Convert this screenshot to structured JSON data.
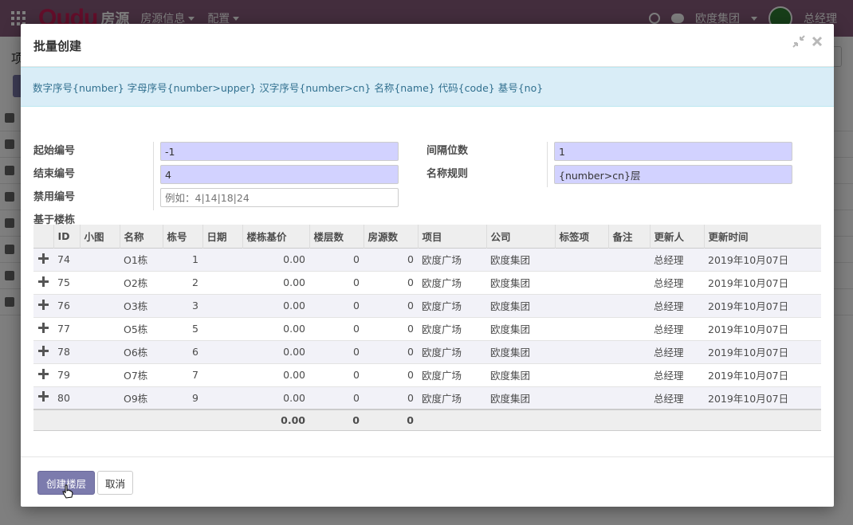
{
  "app": {
    "brand": "Oudu",
    "brand_sub": "房源",
    "menu": [
      "房源信息",
      "配置"
    ],
    "company": "欧度集团",
    "user": "总经理",
    "page_title": "项"
  },
  "modal": {
    "title": "批量创建",
    "info": "数字序号{number} 字母序号{number>upper} 汉字序号{number>cn} 名称{name} 代码{code} 基号{no}",
    "form": {
      "start_label": "起始编号",
      "start_value": "-1",
      "end_label": "结束编号",
      "end_value": "4",
      "disabled_label": "禁用编号",
      "disabled_placeholder": "例如：4|14|18|24",
      "interval_label": "间隔位数",
      "interval_value": "1",
      "name_rule_label": "名称规则",
      "name_rule_value": "{number>cn}层",
      "based_on_label": "基于楼栋"
    },
    "table": {
      "columns": [
        "",
        "ID",
        "小图",
        "名称",
        "栋号",
        "日期",
        "楼栋基价",
        "楼层数",
        "房源数",
        "项目",
        "公司",
        "标签项",
        "备注",
        "更新人",
        "更新时间"
      ],
      "rows": [
        {
          "id": "74",
          "thumb": "",
          "name": "O1栋",
          "no": "1",
          "date": "",
          "price": "0.00",
          "floors": "0",
          "rooms": "0",
          "project": "欧度广场",
          "company": "欧度集团",
          "tags": "",
          "note": "",
          "updater": "总经理",
          "updated": "2019年10月07日"
        },
        {
          "id": "75",
          "thumb": "",
          "name": "O2栋",
          "no": "2",
          "date": "",
          "price": "0.00",
          "floors": "0",
          "rooms": "0",
          "project": "欧度广场",
          "company": "欧度集团",
          "tags": "",
          "note": "",
          "updater": "总经理",
          "updated": "2019年10月07日"
        },
        {
          "id": "76",
          "thumb": "",
          "name": "O3栋",
          "no": "3",
          "date": "",
          "price": "0.00",
          "floors": "0",
          "rooms": "0",
          "project": "欧度广场",
          "company": "欧度集团",
          "tags": "",
          "note": "",
          "updater": "总经理",
          "updated": "2019年10月07日"
        },
        {
          "id": "77",
          "thumb": "",
          "name": "O5栋",
          "no": "5",
          "date": "",
          "price": "0.00",
          "floors": "0",
          "rooms": "0",
          "project": "欧度广场",
          "company": "欧度集团",
          "tags": "",
          "note": "",
          "updater": "总经理",
          "updated": "2019年10月07日"
        },
        {
          "id": "78",
          "thumb": "",
          "name": "O6栋",
          "no": "6",
          "date": "",
          "price": "0.00",
          "floors": "0",
          "rooms": "0",
          "project": "欧度广场",
          "company": "欧度集团",
          "tags": "",
          "note": "",
          "updater": "总经理",
          "updated": "2019年10月07日"
        },
        {
          "id": "79",
          "thumb": "",
          "name": "O7栋",
          "no": "7",
          "date": "",
          "price": "0.00",
          "floors": "0",
          "rooms": "0",
          "project": "欧度广场",
          "company": "欧度集团",
          "tags": "",
          "note": "",
          "updater": "总经理",
          "updated": "2019年10月07日"
        },
        {
          "id": "80",
          "thumb": "",
          "name": "O9栋",
          "no": "9",
          "date": "",
          "price": "0.00",
          "floors": "0",
          "rooms": "0",
          "project": "欧度广场",
          "company": "欧度集团",
          "tags": "",
          "note": "",
          "updater": "总经理",
          "updated": "2019年10月07日"
        }
      ],
      "totals": {
        "price": "0.00",
        "floors": "0",
        "rooms": "0"
      }
    },
    "buttons": {
      "create": "创建楼层",
      "cancel": "取消"
    }
  },
  "colors": {
    "primary": "#7c7bad",
    "info_bg": "#d9edf7",
    "info_text": "#31708f",
    "required_input_bg": "#d2d2ff",
    "topbar": "#875a7b"
  }
}
